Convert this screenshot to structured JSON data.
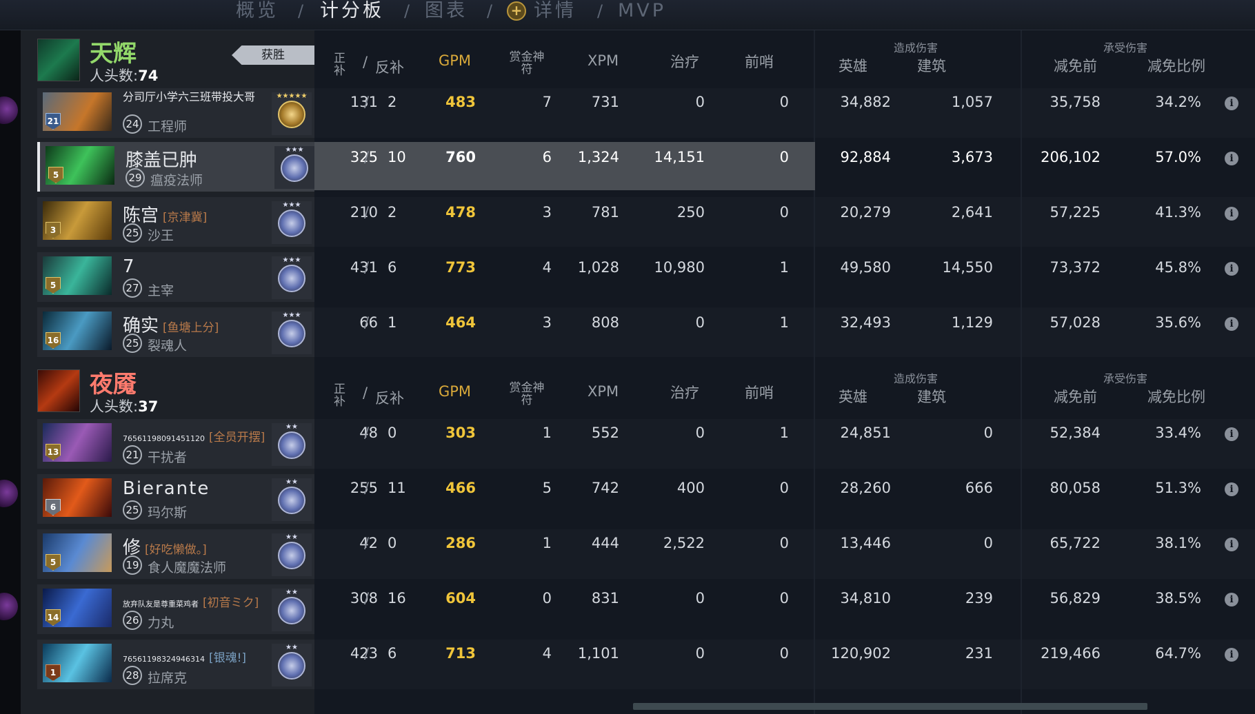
{
  "nav": {
    "tabs": [
      "概览",
      "计分板",
      "图表",
      "详情",
      "MVP"
    ],
    "separator": "/"
  },
  "radiant": {
    "name": "天辉",
    "kills_label": "人头数:",
    "kills": "74",
    "result": "获胜",
    "players": [
      {
        "name": "分司厅小学六三班带投大哥",
        "guild": "",
        "level": "24",
        "hero": "工程师",
        "badge": "21",
        "badge_color": "blue",
        "medal": "gold",
        "lh": "131",
        "dn": "2",
        "gpm": "483",
        "bounty": "7",
        "xpm": "731",
        "heal": "0",
        "wards": "0",
        "hero_dmg": "34,882",
        "bldg_dmg": "1,057",
        "dmg_pre": "35,758",
        "dmg_pct": "34.2%"
      },
      {
        "name": "膝盖已肿",
        "guild": "",
        "level": "29",
        "hero": "瘟疫法师",
        "badge": "5",
        "badge_color": "gold",
        "medal": "silver",
        "lh": "325",
        "dn": "10",
        "gpm": "760",
        "bounty": "6",
        "xpm": "1,324",
        "heal": "14,151",
        "wards": "0",
        "hero_dmg": "92,884",
        "bldg_dmg": "3,673",
        "dmg_pre": "206,102",
        "dmg_pct": "57.0%"
      },
      {
        "name": "陈宫",
        "guild": "[京津冀]",
        "level": "25",
        "hero": "沙王",
        "badge": "3",
        "badge_color": "gold",
        "medal": "silver",
        "lh": "210",
        "dn": "2",
        "gpm": "478",
        "bounty": "3",
        "xpm": "781",
        "heal": "250",
        "wards": "0",
        "hero_dmg": "20,279",
        "bldg_dmg": "2,641",
        "dmg_pre": "57,225",
        "dmg_pct": "41.3%"
      },
      {
        "name": "7",
        "guild": "",
        "level": "27",
        "hero": "主宰",
        "badge": "5",
        "badge_color": "gold",
        "medal": "silver",
        "lh": "431",
        "dn": "6",
        "gpm": "773",
        "bounty": "4",
        "xpm": "1,028",
        "heal": "10,980",
        "wards": "1",
        "hero_dmg": "49,580",
        "bldg_dmg": "14,550",
        "dmg_pre": "73,372",
        "dmg_pct": "45.8%"
      },
      {
        "name": "确实",
        "guild": "[鱼塘上分]",
        "level": "25",
        "hero": "裂魂人",
        "badge": "16",
        "badge_color": "gold",
        "medal": "silver",
        "lh": "66",
        "dn": "1",
        "gpm": "464",
        "bounty": "3",
        "xpm": "808",
        "heal": "0",
        "wards": "1",
        "hero_dmg": "32,493",
        "bldg_dmg": "1,129",
        "dmg_pre": "57,028",
        "dmg_pct": "35.6%"
      }
    ]
  },
  "dire": {
    "name": "夜魇",
    "kills_label": "人头数:",
    "kills": "37",
    "players": [
      {
        "name": "76561198091451120",
        "guild": "[全员开摆]",
        "level": "21",
        "hero": "干扰者",
        "badge": "13",
        "badge_color": "gold",
        "medal": "silver",
        "lh": "48",
        "dn": "0",
        "gpm": "303",
        "bounty": "1",
        "xpm": "552",
        "heal": "0",
        "wards": "1",
        "hero_dmg": "24,851",
        "bldg_dmg": "0",
        "dmg_pre": "52,384",
        "dmg_pct": "33.4%"
      },
      {
        "name": "Bierante",
        "guild": "",
        "level": "25",
        "hero": "玛尔斯",
        "badge": "6",
        "badge_color": "silver",
        "medal": "silver",
        "lh": "255",
        "dn": "11",
        "gpm": "466",
        "bounty": "5",
        "xpm": "742",
        "heal": "400",
        "wards": "0",
        "hero_dmg": "28,260",
        "bldg_dmg": "666",
        "dmg_pre": "80,058",
        "dmg_pct": "51.3%"
      },
      {
        "name": "修",
        "guild": "[好吃懒做。]",
        "level": "19",
        "hero": "食人魔魔法师",
        "badge": "5",
        "badge_color": "gold",
        "medal": "silver",
        "lh": "42",
        "dn": "0",
        "gpm": "286",
        "bounty": "1",
        "xpm": "444",
        "heal": "2,522",
        "wards": "0",
        "hero_dmg": "13,446",
        "bldg_dmg": "0",
        "dmg_pre": "65,722",
        "dmg_pct": "38.1%"
      },
      {
        "name": "放弃队友是尊重菜鸡者",
        "guild": "[初音ミク]",
        "level": "26",
        "hero": "力丸",
        "badge": "14",
        "badge_color": "gold",
        "medal": "silver",
        "lh": "308",
        "dn": "16",
        "gpm": "604",
        "bounty": "0",
        "xpm": "831",
        "heal": "0",
        "wards": "0",
        "hero_dmg": "34,810",
        "bldg_dmg": "239",
        "dmg_pre": "56,829",
        "dmg_pct": "38.5%"
      },
      {
        "name": "76561198324946314",
        "guild": "[银魂!]",
        "level": "28",
        "hero": "拉席克",
        "badge": "1",
        "badge_color": "bronze",
        "medal": "silver",
        "lh": "423",
        "dn": "6",
        "gpm": "713",
        "bounty": "4",
        "xpm": "1,101",
        "heal": "0",
        "wards": "0",
        "hero_dmg": "120,902",
        "bldg_dmg": "231",
        "dmg_pre": "219,466",
        "dmg_pct": "64.7%"
      }
    ]
  },
  "headers": {
    "lh": "正\n补",
    "slash": "/",
    "dn": "反补",
    "gpm": "GPM",
    "bounty": "赏金神\n符",
    "xpm": "XPM",
    "heal": "治疗",
    "wards": "前哨",
    "dmg_dealt_group": "造成伤害",
    "hero_dmg": "英雄",
    "bldg_dmg": "建筑",
    "dmg_taken_group": "承受伤害",
    "dmg_pre": "减免前",
    "dmg_pct": "减免比例"
  },
  "icons": {
    "info": "info-icon",
    "plus": "plus-icon"
  },
  "colors": {
    "gpm": "#f0c53a",
    "radiant": "#93d96a",
    "dire": "#ff7b6e",
    "guild": "#b97a4a"
  }
}
